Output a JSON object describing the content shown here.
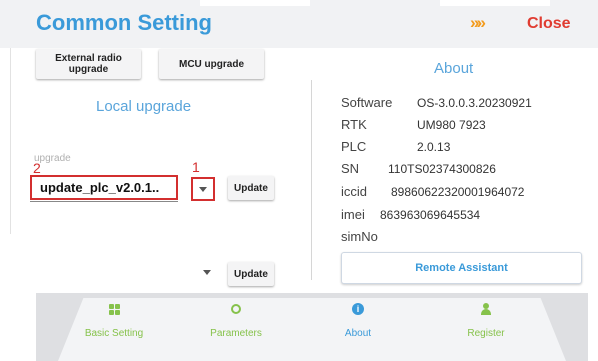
{
  "header": {
    "title": "Common Setting",
    "arrows": "»»",
    "close_label": "Close"
  },
  "tabs": {
    "external_radio_upgrade": "External radio upgrade",
    "mcu_upgrade": "MCU upgrade"
  },
  "local_upgrade": {
    "heading": "Local upgrade",
    "field_hint": "upgrade",
    "file_value": "update_plc_v2.0.1..",
    "update_label": "Update",
    "second_update_label": "Update",
    "marker_1": "1",
    "marker_2": "2"
  },
  "about": {
    "heading": "About",
    "rows": [
      {
        "label": "Software",
        "value": "OS-3.0.0.3.20230921"
      },
      {
        "label": "RTK",
        "value": "UM980 7923"
      },
      {
        "label": "PLC",
        "value": "2.0.13"
      },
      {
        "label": "SN",
        "value": "110TS02374300826"
      },
      {
        "label": "iccid",
        "value": "89860622320001964072"
      },
      {
        "label": "imei",
        "value": "863963069645534"
      },
      {
        "label": "simNo",
        "value": ""
      }
    ],
    "remote_assistant_label": "Remote Assistant"
  },
  "nav": {
    "items": [
      {
        "label": "Basic Setting",
        "icon": "grid-icon",
        "color": "#86c24b"
      },
      {
        "label": "Parameters",
        "icon": "parameters-icon",
        "color": "#86c24b"
      },
      {
        "label": "About",
        "icon": "info-icon",
        "color": "#3a9ad9"
      },
      {
        "label": "Register",
        "icon": "user-icon",
        "color": "#86c24b"
      }
    ]
  },
  "colors": {
    "title_blue": "#3a9ad9",
    "close_red": "#e03c31",
    "arrows_orange": "#f39b1c",
    "annotation_red": "#d32f2f",
    "nav_green": "#86c24b"
  }
}
